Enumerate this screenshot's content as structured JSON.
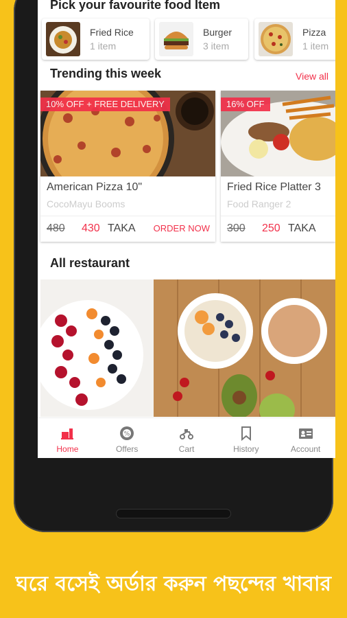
{
  "header": {
    "categories_title": "Pick your favourite food Item"
  },
  "categories": [
    {
      "name": "Fried Rice",
      "count": "1 item"
    },
    {
      "name": "Burger",
      "count": "3 item"
    },
    {
      "name": "Pizza",
      "count": "1 item"
    }
  ],
  "trending": {
    "title": "Trending this week",
    "view_all": "View all",
    "cards": [
      {
        "badge": "10% OFF + FREE DELIVERY",
        "title": "American  Pizza 10\"",
        "restaurant": "CocoMayu Booms",
        "old_price": "480",
        "new_price": "430",
        "currency": "TAKA",
        "cta": "ORDER NOW"
      },
      {
        "badge": "16% OFF",
        "title": "Fried Rice Platter 3",
        "restaurant": "Food Ranger 2",
        "old_price": "300",
        "new_price": "250",
        "currency": "TAKA"
      }
    ]
  },
  "restaurants": {
    "title": "All restaurant"
  },
  "nav": {
    "items": [
      {
        "label": "Home",
        "icon": "home-icon",
        "active": true
      },
      {
        "label": "Offers",
        "icon": "badge-icon"
      },
      {
        "label": "Cart",
        "icon": "scooter-icon"
      },
      {
        "label": "History",
        "icon": "bookmark-icon"
      },
      {
        "label": "Account",
        "icon": "id-card-icon"
      }
    ]
  },
  "tagline": "ঘরে বসেই অর্ডার করুন পছন্দের খাবার",
  "colors": {
    "accent": "#F2304A",
    "background": "#F7C21A"
  }
}
